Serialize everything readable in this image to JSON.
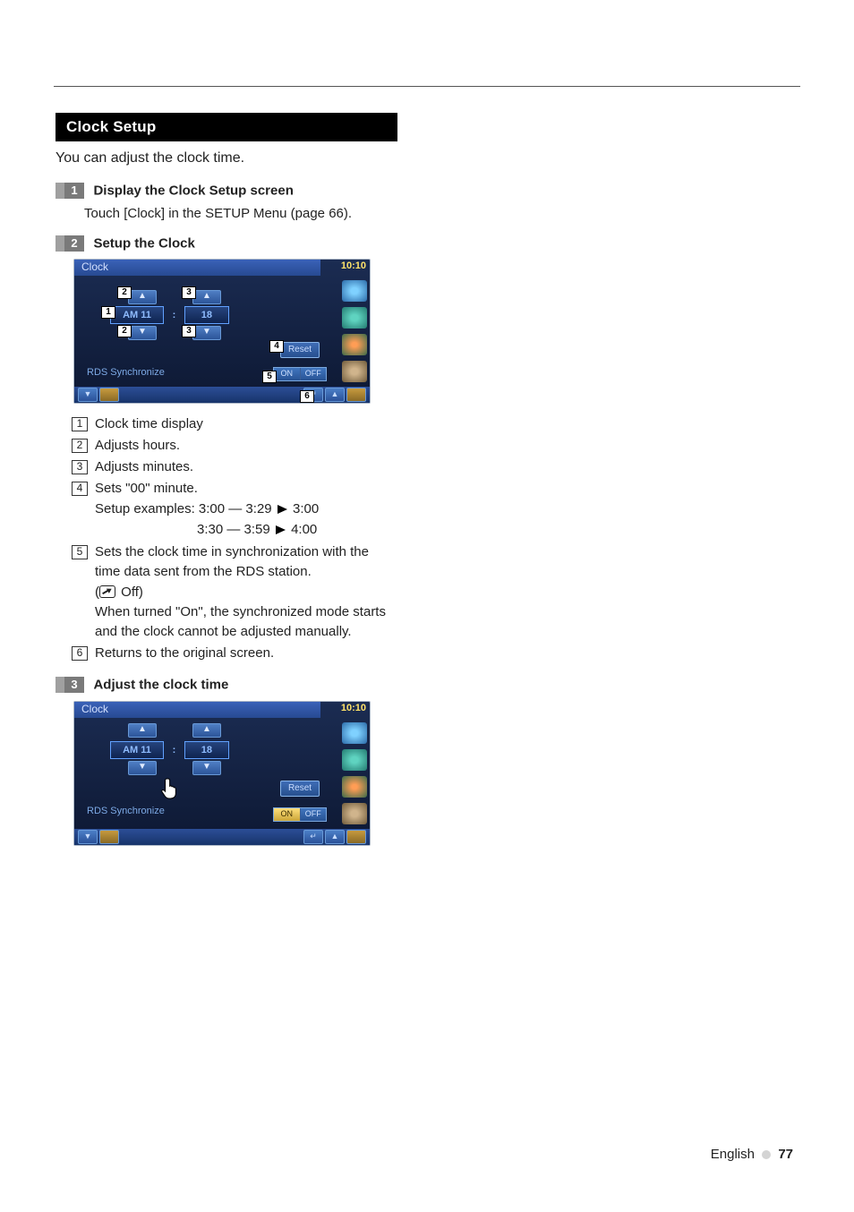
{
  "section_title": "Clock Setup",
  "intro": "You can adjust the clock time.",
  "steps": {
    "s1": {
      "num": "1",
      "title": "Display the Clock Setup screen",
      "body": "Touch [Clock] in the SETUP Menu (page 66)."
    },
    "s2": {
      "num": "2",
      "title": "Setup the Clock"
    },
    "s3": {
      "num": "3",
      "title": "Adjust the clock time"
    }
  },
  "shot": {
    "title": "Clock",
    "time": "10:10",
    "hour": "AM 11",
    "sep": ":",
    "minute": "18",
    "reset": "Reset",
    "rds_label": "RDS Synchronize",
    "on": "ON",
    "off": "OFF",
    "arrow_up": "▲",
    "arrow_down": "▼",
    "back": "↵"
  },
  "callouts": {
    "c1": "1",
    "c2": "2",
    "c3": "3",
    "c4": "4",
    "c5": "5",
    "c6": "6"
  },
  "legend": {
    "l1": "Clock time display",
    "l2": "Adjusts hours.",
    "l3": "Adjusts minutes.",
    "l4": "Sets \"00\" minute.",
    "l4_ex_label": "Setup examples:",
    "l4_ex_a_left": "3:00 — 3:29",
    "l4_ex_a_right": "3:00",
    "l4_ex_b_left": "3:30 — 3:59",
    "l4_ex_b_right": "4:00",
    "l5a": "Sets the clock time in synchronization with the time data sent from the RDS station.",
    "l5_off": "Off)",
    "l5_open": "(",
    "l5b": "When turned \"On\", the synchronized mode starts and the clock cannot be adjusted manually.",
    "l6": "Returns to the original screen."
  },
  "footer": {
    "lang": "English",
    "page": "77"
  }
}
